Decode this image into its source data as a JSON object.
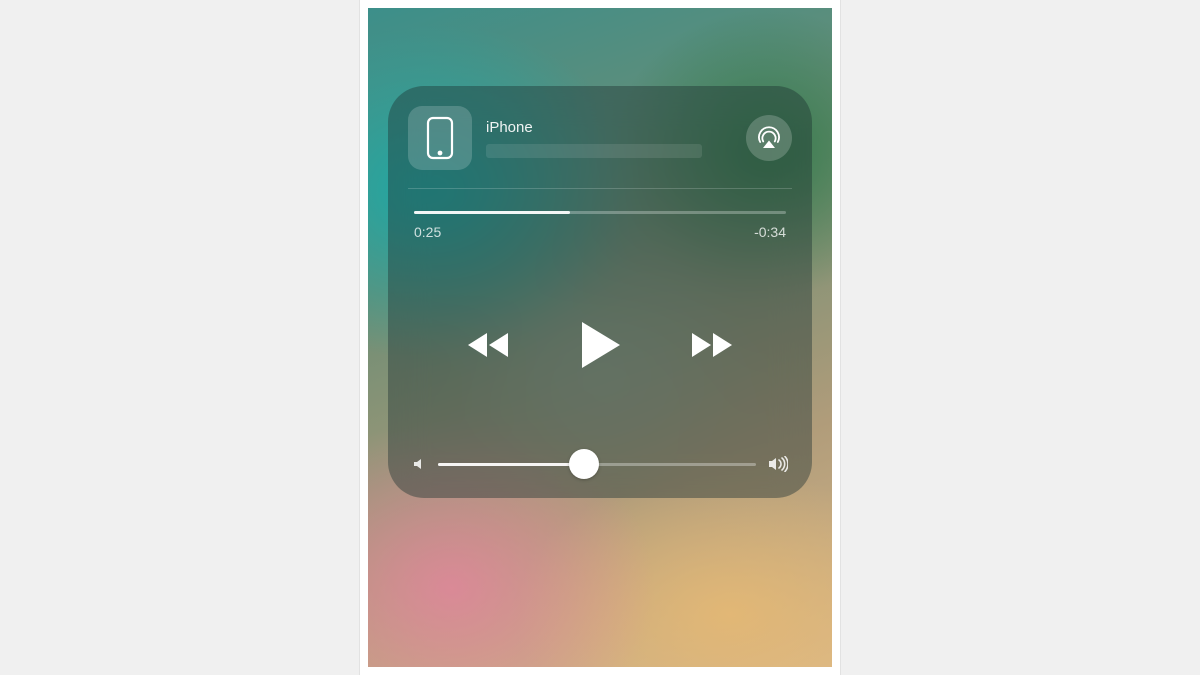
{
  "device": {
    "name": "iPhone"
  },
  "playback": {
    "elapsed": "0:25",
    "remaining": "-0:34",
    "progress_percent": 42
  },
  "volume": {
    "percent": 46
  },
  "icons": {
    "device": "iphone-icon",
    "airplay": "airplay-icon",
    "rewind": "rewind-icon",
    "play": "play-icon",
    "forward": "forward-icon",
    "volume_low": "volume-low-icon",
    "volume_high": "volume-high-icon"
  }
}
